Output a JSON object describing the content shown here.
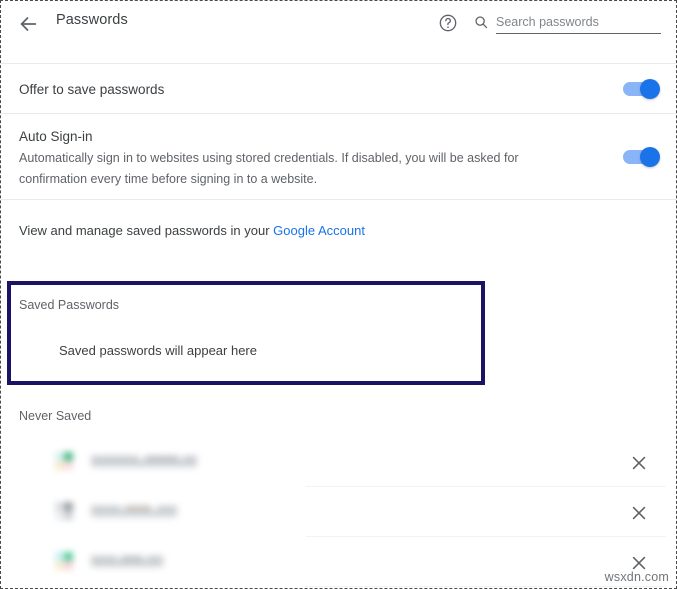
{
  "header": {
    "title": "Passwords",
    "back_icon": "back-arrow-icon",
    "help_icon": "help-circle-icon",
    "search_icon": "search-icon",
    "search_placeholder": "Search passwords",
    "search_value": ""
  },
  "settings": {
    "offer_to_save": {
      "label": "Offer to save passwords",
      "toggle_on": true
    },
    "auto_signin": {
      "title": "Auto Sign-in",
      "description": "Automatically sign in to websites using stored credentials. If disabled, you will be asked for confirmation every time before signing in to a website.",
      "toggle_on": true
    }
  },
  "google_account": {
    "text_before": "View and manage saved passwords in your ",
    "link_label": "Google Account"
  },
  "saved_passwords": {
    "heading": "Saved Passwords",
    "empty_message": "Saved passwords will appear here",
    "highlight_color": "#1b1464",
    "highlighted": true
  },
  "never_saved": {
    "heading": "Never Saved",
    "rows": [
      {
        "site_label": "",
        "redacted": true,
        "favicon_name": "site-favicon-teal",
        "favicon_colors": [
          "#cfeef0",
          "#2fae74",
          "#f6e7c5",
          "#f9d7dc"
        ],
        "blur_width": 112,
        "remove_icon": "close-icon"
      },
      {
        "site_label": "",
        "redacted": true,
        "favicon_name": "site-favicon-gray",
        "favicon_colors": [
          "#d7d9dc",
          "#8e9296",
          "#e9ebee",
          "#c8cbcf"
        ],
        "blur_width": 92,
        "remove_icon": "close-icon"
      },
      {
        "site_label": "",
        "redacted": true,
        "favicon_name": "site-favicon-green",
        "favicon_colors": [
          "#bdeef5",
          "#3fc48a",
          "#f7e9c8",
          "#f7ccd6"
        ],
        "blur_width": 73,
        "remove_icon": "close-icon"
      }
    ]
  },
  "watermark": {
    "text": "wsxdn.com"
  },
  "colors": {
    "accent": "#1a73e8",
    "toggle_track": "#8ab4f8",
    "text_primary": "#3c4043",
    "text_secondary": "#5f6368",
    "divider": "#e8eaed",
    "highlight": "#1b1464"
  }
}
